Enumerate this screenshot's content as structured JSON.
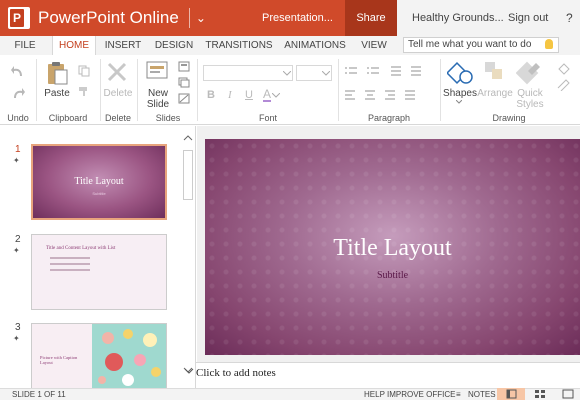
{
  "titlebar": {
    "app_name": "PowerPoint Online",
    "document_title": "Presentation...",
    "share_label": "Share",
    "user_name": "Healthy Grounds...",
    "signout_label": "Sign out",
    "help_label": "?"
  },
  "tabs": [
    {
      "label": "FILE"
    },
    {
      "label": "HOME",
      "active": true
    },
    {
      "label": "INSERT"
    },
    {
      "label": "DESIGN"
    },
    {
      "label": "TRANSITIONS"
    },
    {
      "label": "ANIMATIONS"
    },
    {
      "label": "VIEW"
    }
  ],
  "tellme": {
    "placeholder": "Tell me what you want to do"
  },
  "ribbon": {
    "groups": [
      "Undo",
      "Clipboard",
      "Delete",
      "Slides",
      "Font",
      "Paragraph",
      "Drawing"
    ],
    "buttons": {
      "paste": "Paste",
      "delete": "Delete",
      "new_slide_line1": "New",
      "new_slide_line2": "Slide",
      "shapes": "Shapes",
      "arrange": "Arrange",
      "quick_styles_line1": "Quick",
      "quick_styles_line2": "Styles"
    }
  },
  "slides_panel": {
    "slides": [
      {
        "number": "1",
        "title": "Title Layout",
        "subtitle": "Subtitle"
      },
      {
        "number": "2",
        "title": "Title and Content Layout with List"
      },
      {
        "number": "3",
        "title": "Picture with Caption Layout"
      }
    ]
  },
  "main_slide": {
    "title": "Title Layout",
    "subtitle": "Subtitle"
  },
  "notes": {
    "placeholder": "Click to add notes"
  },
  "statusbar": {
    "slide_counter": "SLIDE 1 OF 11",
    "help_improve": "HELP IMPROVE OFFICE",
    "notes_label": "NOTES"
  },
  "colors": {
    "accent": "#d04a2a",
    "share_bg": "#a8361b",
    "slide_purple": "#86466f"
  }
}
